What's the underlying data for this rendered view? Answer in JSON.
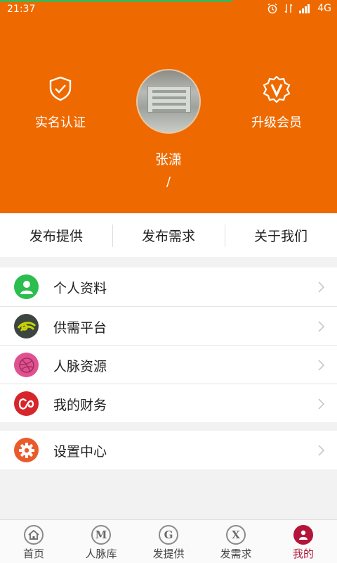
{
  "status_bar": {
    "time": "21:37",
    "network": "4G",
    "progress_fraction": 0.69
  },
  "profile": {
    "verify": {
      "label": "实名认证",
      "icon": "shield-check-icon"
    },
    "vip": {
      "label": "升级会员",
      "icon": "vip-badge-icon"
    },
    "name": "张潇",
    "subtitle": "/"
  },
  "tabs": [
    {
      "label": "发布提供"
    },
    {
      "label": "发布需求"
    },
    {
      "label": "关于我们"
    }
  ],
  "menu": [
    {
      "label": "个人资料",
      "icon": "person-icon",
      "color": "#2bbd4e"
    },
    {
      "label": "供需平台",
      "icon": "platform-icon",
      "color": "#3d4540"
    },
    {
      "label": "人脉资源",
      "icon": "dribbble-icon",
      "color": "#e0518f"
    },
    {
      "label": "我的财务",
      "icon": "finance-icon",
      "color": "#d6252b"
    }
  ],
  "settings": {
    "label": "设置中心",
    "icon": "gear-icon",
    "color": "#ea5b2c"
  },
  "bottom_nav": [
    {
      "label": "首页",
      "icon": "home-icon"
    },
    {
      "label": "人脉库",
      "icon": "m-icon",
      "glyph": "M"
    },
    {
      "label": "发提供",
      "icon": "g-icon",
      "glyph": "G"
    },
    {
      "label": "发需求",
      "icon": "x-icon",
      "glyph": "X"
    },
    {
      "label": "我的",
      "icon": "profile-icon",
      "active": true
    }
  ],
  "colors": {
    "header": "#ee6a00",
    "active_tab": "#b3163a"
  }
}
